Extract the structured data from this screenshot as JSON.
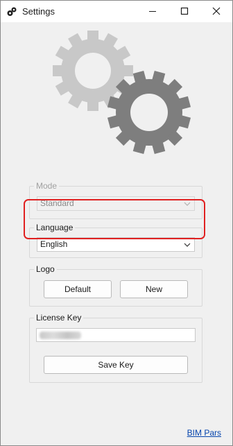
{
  "window": {
    "title": "Settings",
    "title_icon": "gears-icon",
    "controls": {
      "minimize": "minimize-icon",
      "maximize": "maximize-icon",
      "close": "close-icon"
    }
  },
  "illustration": {
    "icon": "gears-icon",
    "colors": {
      "light_gear": "#c8c8c8",
      "dark_gear": "#7e7e7e"
    }
  },
  "mode": {
    "label": "Mode",
    "value": "Standard",
    "enabled": false
  },
  "language": {
    "label": "Language",
    "value": "English",
    "highlight_color": "#e02020"
  },
  "logo": {
    "label": "Logo",
    "default_button": "Default",
    "new_button": "New"
  },
  "license": {
    "label": "License Key",
    "save_button": "Save Key"
  },
  "footer": {
    "link": "BIM Pars"
  }
}
